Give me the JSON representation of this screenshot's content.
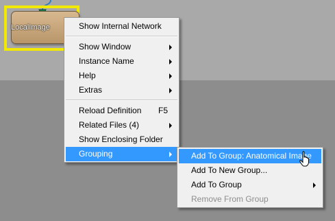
{
  "node": {
    "label": "LocalImage"
  },
  "context_menu": {
    "show_internal_network": "Show Internal Network",
    "show_window": "Show Window",
    "instance_name": "Instance Name",
    "help": "Help",
    "extras": "Extras",
    "reload_definition": "Reload Definition",
    "reload_shortcut": "F5",
    "related_files": "Related Files (4)",
    "show_enclosing_folder": "Show Enclosing Folder",
    "grouping": "Grouping"
  },
  "grouping_submenu": {
    "add_to_group_anatomical": "Add To Group: Anatomical Image",
    "add_to_new_group": "Add To New Group...",
    "add_to_group": "Add To Group",
    "remove_from_group": "Remove From Group"
  },
  "colors": {
    "highlight": "#3399ff",
    "selection_frame": "#f2e900",
    "node_fill": "#c8a67b",
    "connection": "#2f7fc0",
    "connector_arrow": "#1f7f4f"
  }
}
